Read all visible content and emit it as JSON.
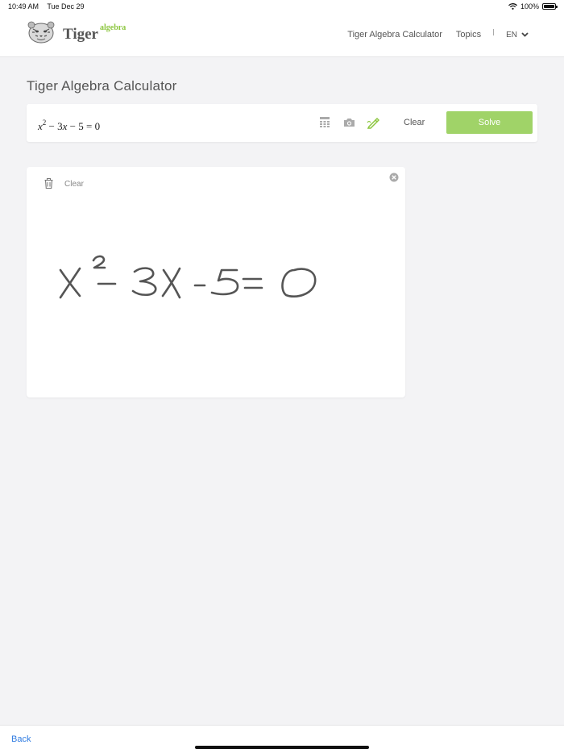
{
  "status_bar": {
    "time": "10:49 AM",
    "date": "Tue Dec 29",
    "battery": "100%"
  },
  "header": {
    "logo_word": "Tiger",
    "logo_sup": "algebra",
    "nav": [
      {
        "label": "Tiger Algebra Calculator"
      },
      {
        "label": "Topics"
      }
    ],
    "language": "EN"
  },
  "page_title": "Tiger Algebra Calculator",
  "input_bar": {
    "expression": {
      "var": "x",
      "exp": "2",
      "rest_1": " − 3",
      "var_2": "x",
      "rest_2": " − 5 = 0"
    },
    "icons": [
      "calculator-icon",
      "camera-icon",
      "pen-icon"
    ],
    "clear_label": "Clear",
    "solve_label": "Solve"
  },
  "draw_panel": {
    "clear_label": "Clear",
    "handwriting": "x² − 3x − 5 = 0"
  },
  "bottom": {
    "back_label": "Back"
  },
  "colors": {
    "accent_green": "#8cc63f",
    "solve_green": "#a0d368",
    "link_blue": "#2f7be1"
  }
}
